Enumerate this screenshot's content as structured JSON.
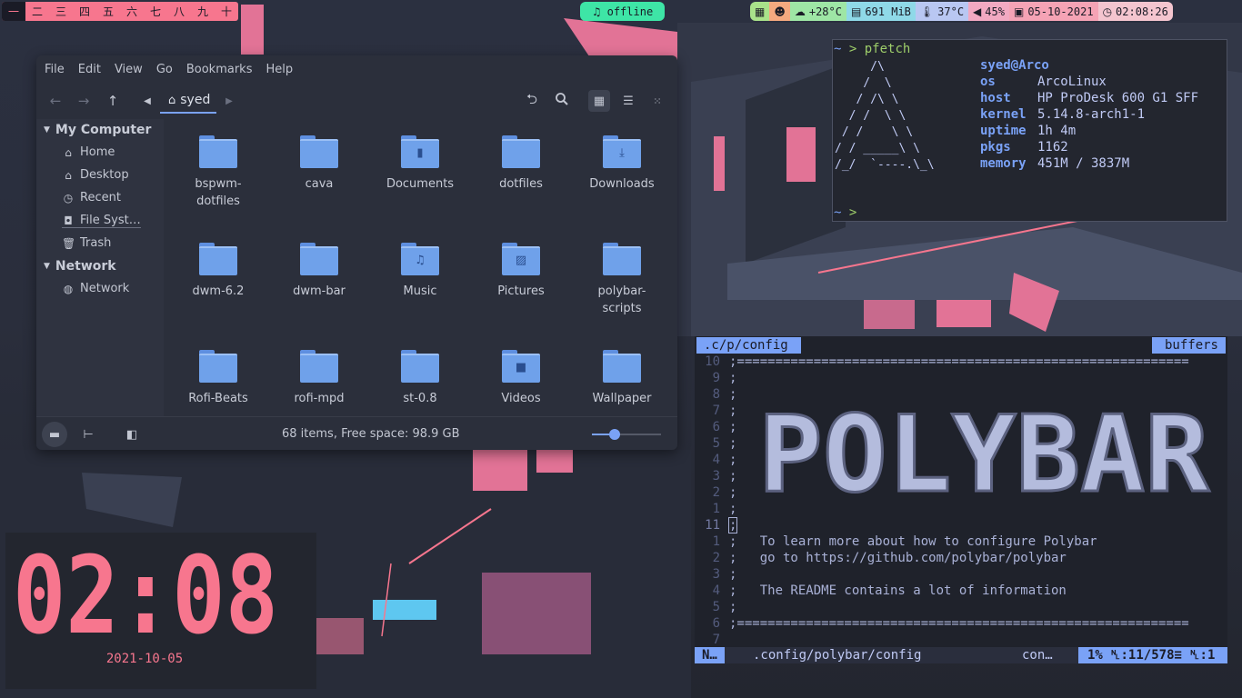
{
  "colors": {
    "accent_blue": "#7aa2f7",
    "accent_pink": "#f7768e",
    "music_green": "#3ee5a6",
    "panel_bg": "#2b2f3b"
  },
  "topbar": {
    "workspaces": [
      "一",
      "二",
      "三",
      "四",
      "五",
      "六",
      "七",
      "八",
      "九",
      "十"
    ],
    "active_workspace": 0,
    "music": {
      "icon": "music-note-icon",
      "label": "offline"
    },
    "modules": [
      {
        "name": "apps",
        "icon": "grid-icon",
        "text": "",
        "color": "#a9e28a"
      },
      {
        "name": "reddit",
        "icon": "reddit-icon",
        "text": "",
        "color": "#f5a97f"
      },
      {
        "name": "weather",
        "icon": "cloud-icon",
        "text": "+28°C",
        "color": "#9ee6a5"
      },
      {
        "name": "memory",
        "icon": "ram-icon",
        "text": "691 MiB",
        "color": "#8fd9e8"
      },
      {
        "name": "temperature",
        "icon": "thermometer-icon",
        "text": "37°C",
        "color": "#b9c7f2"
      },
      {
        "name": "volume",
        "icon": "volume-icon",
        "text": "45%",
        "color": "#f2a9c2"
      },
      {
        "name": "date",
        "icon": "calendar-icon",
        "text": "05-10-2021",
        "color": "#f5a3b5"
      },
      {
        "name": "time",
        "icon": "clock-icon",
        "text": "02:08:26",
        "color": "#f4c5cf"
      }
    ]
  },
  "file_manager": {
    "menu": [
      "File",
      "Edit",
      "View",
      "Go",
      "Bookmarks",
      "Help"
    ],
    "breadcrumb": "syed",
    "sidebar": {
      "sections": [
        {
          "title": "My Computer",
          "items": [
            {
              "label": "Home",
              "icon": "home-icon"
            },
            {
              "label": "Desktop",
              "icon": "desktop-icon"
            },
            {
              "label": "Recent",
              "icon": "recent-icon"
            },
            {
              "label": "File Syst…",
              "icon": "drive-icon"
            },
            {
              "label": "Trash",
              "icon": "trash-icon"
            }
          ]
        },
        {
          "title": "Network",
          "items": [
            {
              "label": "Network",
              "icon": "network-icon"
            }
          ]
        }
      ]
    },
    "files": [
      {
        "name": "bspwm-dotfiles",
        "line1": "bspwm-",
        "line2": "dotfiles",
        "emblem": ""
      },
      {
        "name": "cava",
        "line1": "cava",
        "line2": "",
        "emblem": ""
      },
      {
        "name": "Documents",
        "line1": "Documents",
        "line2": "",
        "emblem": "document"
      },
      {
        "name": "dotfiles",
        "line1": "dotfiles",
        "line2": "",
        "emblem": ""
      },
      {
        "name": "Downloads",
        "line1": "Downloads",
        "line2": "",
        "emblem": "download"
      },
      {
        "name": "dwm-6.2",
        "line1": "dwm-6.2",
        "line2": "",
        "emblem": ""
      },
      {
        "name": "dwm-bar",
        "line1": "dwm-bar",
        "line2": "",
        "emblem": ""
      },
      {
        "name": "Music",
        "line1": "Music",
        "line2": "",
        "emblem": "music"
      },
      {
        "name": "Pictures",
        "line1": "Pictures",
        "line2": "",
        "emblem": "picture"
      },
      {
        "name": "polybar-scripts",
        "line1": "polybar-",
        "line2": "scripts",
        "emblem": ""
      },
      {
        "name": "Rofi-Beats",
        "line1": "Rofi-Beats",
        "line2": "",
        "emblem": ""
      },
      {
        "name": "rofi-mpd",
        "line1": "rofi-mpd",
        "line2": "",
        "emblem": ""
      },
      {
        "name": "st-0.8",
        "line1": "st-0.8",
        "line2": "",
        "emblem": ""
      },
      {
        "name": "Videos",
        "line1": "Videos",
        "line2": "",
        "emblem": "video"
      },
      {
        "name": "Wallpaper",
        "line1": "Wallpaper",
        "line2": "",
        "emblem": ""
      }
    ],
    "status_text": "68 items, Free space: 98.9 GB",
    "zoom_level": 0.33
  },
  "pfetch": {
    "prompt": "~ > pfetch",
    "prompt_end": "~ >",
    "ascii": [
      "     /\\",
      "    /  \\",
      "   / /\\ \\",
      "  / /  \\ \\",
      " / /    \\ \\",
      "/ / _____\\ \\",
      "/_/  `----.\\_\\"
    ],
    "user": "syed@Arco",
    "info": [
      {
        "key": "os",
        "value": "ArcoLinux"
      },
      {
        "key": "host",
        "value": "HP ProDesk 600 G1 SFF"
      },
      {
        "key": "kernel",
        "value": "5.14.8-arch1-1"
      },
      {
        "key": "uptime",
        "value": "1h 4m"
      },
      {
        "key": "pkgs",
        "value": "1162"
      },
      {
        "key": "memory",
        "value": "451M / 3837M"
      }
    ]
  },
  "vim": {
    "tab": ".c/p/config",
    "buffers": "buffers",
    "art_text": "POLYBAR",
    "lines": [
      {
        "num": "10",
        "text": ";===========================================================",
        "cur": false
      },
      {
        "num": "9",
        "text": ";",
        "cur": false
      },
      {
        "num": "8",
        "text": ";",
        "cur": false
      },
      {
        "num": "7",
        "text": ";",
        "cur": false
      },
      {
        "num": "6",
        "text": ";",
        "cur": false
      },
      {
        "num": "5",
        "text": ";",
        "cur": false
      },
      {
        "num": "4",
        "text": ";",
        "cur": false
      },
      {
        "num": "3",
        "text": ";",
        "cur": false
      },
      {
        "num": "2",
        "text": ";",
        "cur": false
      },
      {
        "num": "1",
        "text": ";",
        "cur": false
      },
      {
        "num": "11",
        "text": ";",
        "cur": true
      },
      {
        "num": "1",
        "text": ";   To learn more about how to configure Polybar",
        "cur": false
      },
      {
        "num": "2",
        "text": ";   go to https://github.com/polybar/polybar",
        "cur": false
      },
      {
        "num": "3",
        "text": ";",
        "cur": false
      },
      {
        "num": "4",
        "text": ";   The README contains a lot of information",
        "cur": false
      },
      {
        "num": "5",
        "text": ";",
        "cur": false
      },
      {
        "num": "6",
        "text": ";===========================================================",
        "cur": false
      },
      {
        "num": "7",
        "text": "",
        "cur": false
      }
    ],
    "status": {
      "mode": "N…",
      "file": ".config/polybar/config",
      "filetype": "con…",
      "percent": "1%",
      "position": "␤:11/578≡ ␤:1"
    }
  },
  "clock": {
    "time": "02:08",
    "date": "2021-10-05"
  }
}
